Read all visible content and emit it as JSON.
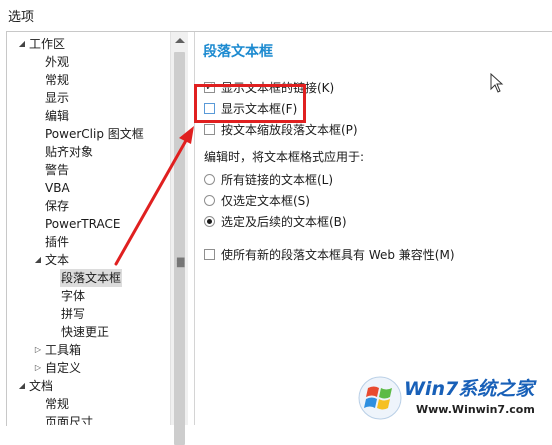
{
  "window": {
    "title": "选项"
  },
  "tree": {
    "rows": [
      {
        "label": "工作区",
        "level": 0,
        "state": "expanded"
      },
      {
        "label": "外观",
        "level": 1
      },
      {
        "label": "常规",
        "level": 1
      },
      {
        "label": "显示",
        "level": 1
      },
      {
        "label": "编辑",
        "level": 1
      },
      {
        "label": "PowerClip 图文框",
        "level": 1
      },
      {
        "label": "贴齐对象",
        "level": 1
      },
      {
        "label": "警告",
        "level": 1
      },
      {
        "label": "VBA",
        "level": 1
      },
      {
        "label": "保存",
        "level": 1
      },
      {
        "label": "PowerTRACE",
        "level": 1
      },
      {
        "label": "插件",
        "level": 1
      },
      {
        "label": "文本",
        "level": 1,
        "state": "expanded"
      },
      {
        "label": "段落文本框",
        "level": 2,
        "selected": true
      },
      {
        "label": "字体",
        "level": 2
      },
      {
        "label": "拼写",
        "level": 2
      },
      {
        "label": "快速更正",
        "level": 2
      },
      {
        "label": "工具箱",
        "level": 1,
        "state": "collapsed"
      },
      {
        "label": "自定义",
        "level": 1,
        "state": "collapsed"
      },
      {
        "label": "文档",
        "level": 0,
        "state": "expanded"
      },
      {
        "label": "常规",
        "level": 1
      },
      {
        "label": "页面尺寸",
        "level": 1
      }
    ]
  },
  "panel": {
    "title": "段落文本框",
    "show_links": {
      "label": "显示文本框的链接(K)",
      "checked": true
    },
    "show_frames": {
      "label": "显示文本框(F)",
      "checked": false
    },
    "scale_text": {
      "label": "按文本缩放段落文本框(P)",
      "checked": false
    },
    "apply_heading": "编辑时，将文本框格式应用于:",
    "apply_options": [
      {
        "label": "所有链接的文本框(L)",
        "selected": false
      },
      {
        "label": "仅选定文本框(S)",
        "selected": false
      },
      {
        "label": "选定及后续的文本框(B)",
        "selected": true
      }
    ],
    "web_compat": {
      "label": "使所有新的段落文本框具有 Web 兼容性(M)",
      "checked": false
    }
  },
  "watermark": {
    "brand": "Win7系统之家",
    "url": "Www.Winwin7.com"
  },
  "colors": {
    "title_blue": "#1c8ad0",
    "highlight_red": "#e02020",
    "selected_bg": "#dcdcdc"
  }
}
